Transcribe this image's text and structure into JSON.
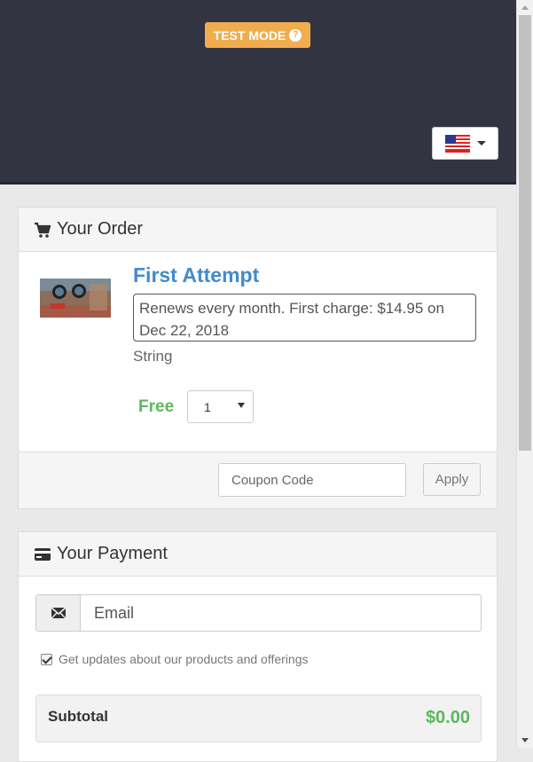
{
  "header": {
    "test_mode_label": "TEST MODE",
    "help_icon": "?",
    "language_flag": "us-flag-icon"
  },
  "order": {
    "heading": "Your Order",
    "product": {
      "title": "First Attempt",
      "renewal_text": "Renews every month. First charge: $14.95 on Dec 22, 2018",
      "subtitle": "String",
      "price_label": "Free",
      "quantity": "1"
    },
    "coupon_placeholder": "Coupon Code",
    "apply_label": "Apply"
  },
  "payment": {
    "heading": "Your Payment",
    "email_placeholder": "Email",
    "updates_label": "Get updates about our products and offerings",
    "updates_checked": true,
    "subtotal_label": "Subtotal",
    "subtotal_value": "$0.00"
  },
  "colors": {
    "header_bg": "#323541",
    "badge": "#f0ad4e",
    "link_blue": "#428bca",
    "success_green": "#5cb85c"
  }
}
